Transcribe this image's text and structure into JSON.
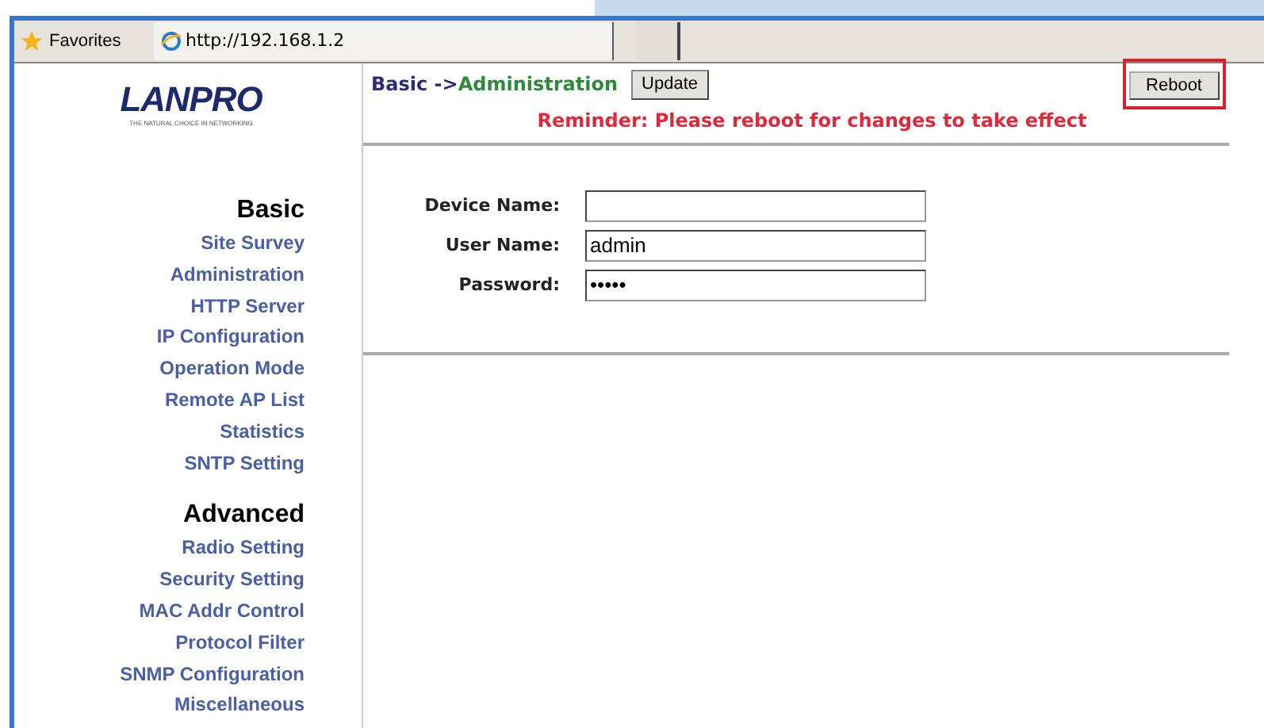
{
  "browser": {
    "favorites": "Favorites",
    "tab_title": "http://192.168.1.2"
  },
  "logo": {
    "name": "LANPRO",
    "tagline": "THE NATURAL CHOICE IN NETWORKING"
  },
  "sidebar": {
    "sections": [
      {
        "title": "Basic",
        "items": [
          "Site Survey",
          "Administration",
          "HTTP Server",
          "IP Configuration",
          "Operation Mode",
          "Remote AP List",
          "Statistics",
          "SNTP Setting"
        ]
      },
      {
        "title": "Advanced",
        "items": [
          "Radio Setting",
          "Security Setting",
          "MAC Addr Control",
          "Protocol Filter",
          "SNMP Configuration",
          "Miscellaneous"
        ]
      }
    ]
  },
  "breadcrumb": {
    "section": "Basic ->",
    "page": "Administration"
  },
  "update_button": "Update",
  "reboot_button": {
    "label": "Reboot",
    "highlighted": true
  },
  "reminder": "Reminder: Please reboot for changes to take effect",
  "form": [
    {
      "label": "Device Name:"
    },
    {
      "label": "User Name:",
      "value": "admin"
    },
    {
      "label": "Password:",
      "value": "•••••"
    }
  ]
}
